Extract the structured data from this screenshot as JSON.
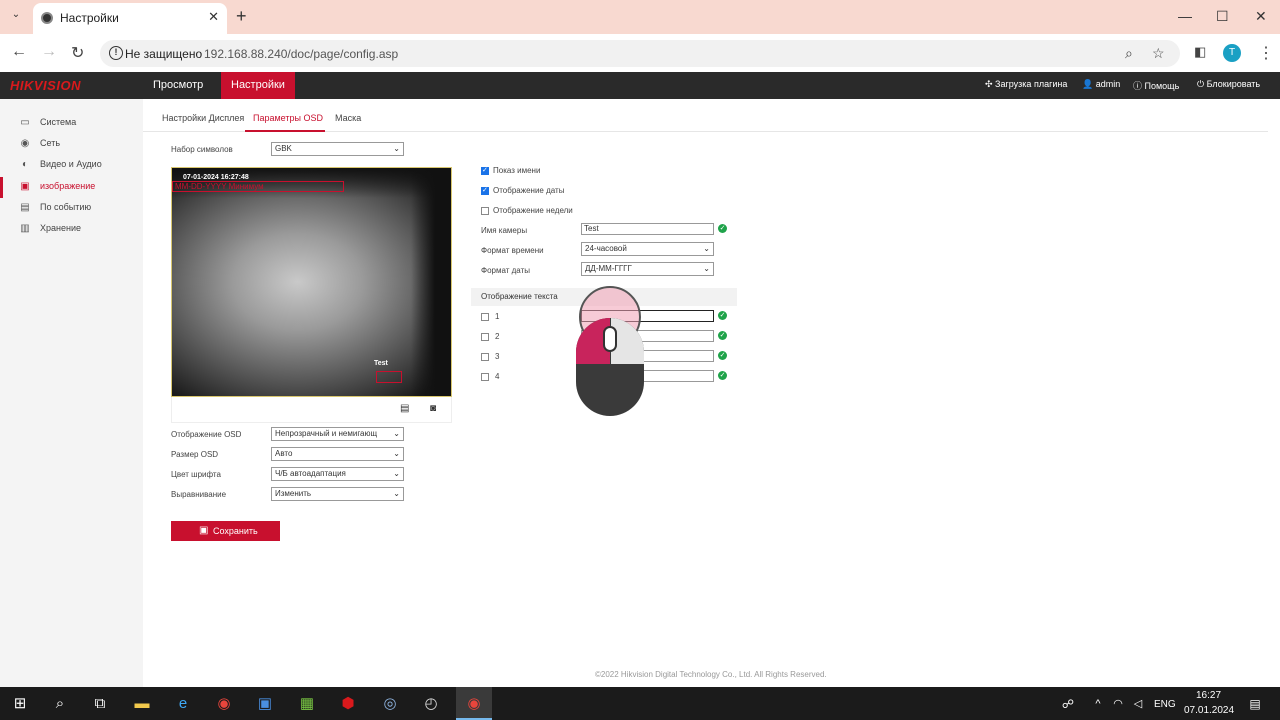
{
  "browser": {
    "tab_title": "Настройки",
    "security_label": "Не защищено",
    "url": "192.168.88.240/doc/page/config.asp",
    "profile_initial": "T"
  },
  "header": {
    "logo": "HIKVISION",
    "nav": [
      "Просмотр",
      "Настройки"
    ],
    "right": {
      "plugin": "Загрузка плагина",
      "user": "admin",
      "help": "Помощь",
      "lock": "Блокировать"
    }
  },
  "sidebar": {
    "items": [
      {
        "label": "Система",
        "icon": "monitor-icon"
      },
      {
        "label": "Сеть",
        "icon": "globe-icon"
      },
      {
        "label": "Видео и Аудио",
        "icon": "video-audio-icon"
      },
      {
        "label": "изображение",
        "icon": "image-icon"
      },
      {
        "label": "По событию",
        "icon": "calendar-icon"
      },
      {
        "label": "Хранение",
        "icon": "storage-icon"
      }
    ],
    "active_index": 3
  },
  "subtabs": [
    "Настройки Дисплея",
    "Параметры OSD",
    "Маска"
  ],
  "charset": {
    "label": "Набор символов",
    "value": "GBK"
  },
  "preview": {
    "date": "07-01-2024 16:27:48",
    "date_format_overlay": "ММ-DD-YYYY Минимум",
    "camera_name_overlay": "Test"
  },
  "osd_settings": [
    {
      "label": "Отображение OSD",
      "value": "Непрозрачный и немигающ"
    },
    {
      "label": "Размер OSD",
      "value": "Авто"
    },
    {
      "label": "Цвет шрифта",
      "value": "Ч/Б автоадаптация"
    },
    {
      "label": "Выравнивание",
      "value": "Изменить"
    }
  ],
  "save_label": "Сохранить",
  "checks": {
    "show_name": {
      "label": "Показ имени",
      "checked": true
    },
    "show_date": {
      "label": "Отображение даты",
      "checked": true
    },
    "show_week": {
      "label": "Отображение недели",
      "checked": false
    }
  },
  "camera_name": {
    "label": "Имя камеры",
    "value": "Test"
  },
  "time_format": {
    "label": "Формат времени",
    "value": "24-часовой"
  },
  "date_format": {
    "label": "Формат даты",
    "value": "ДД-ММ-ГГГГ"
  },
  "text_overlay": {
    "title": "Отображение текста",
    "rows": [
      "1",
      "2",
      "3",
      "4"
    ]
  },
  "footer": "©2022 Hikvision Digital Technology Co., Ltd. All Rights Reserved.",
  "taskbar": {
    "lang": "ENG",
    "time": "16:27",
    "date": "07.01.2024"
  }
}
